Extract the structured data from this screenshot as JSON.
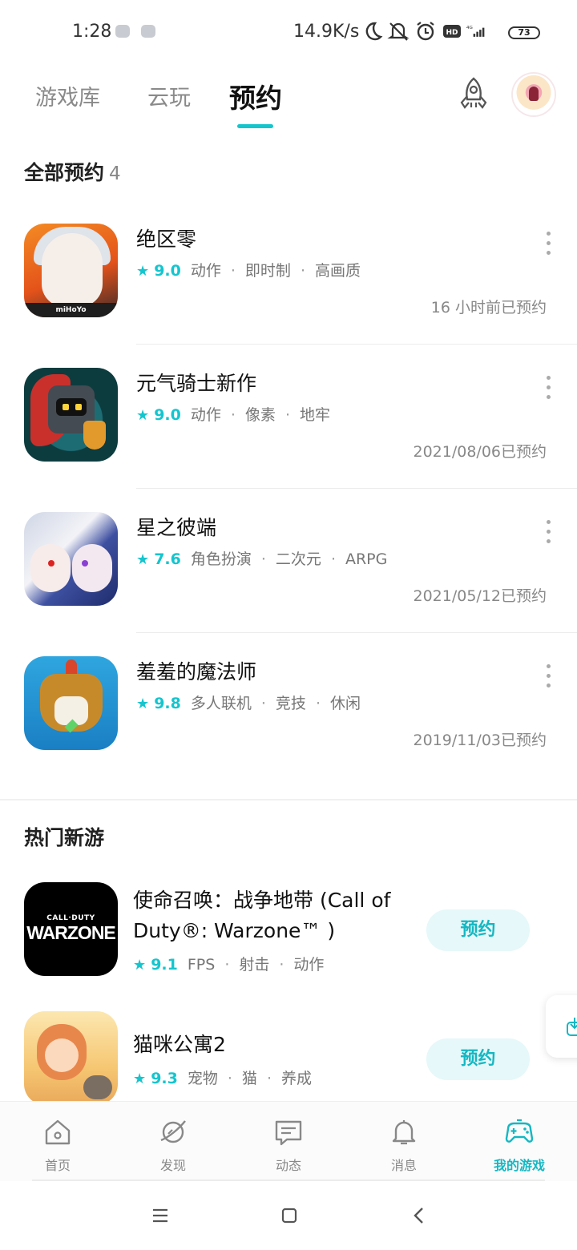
{
  "status_bar": {
    "time": "1:28",
    "net_speed": "14.9K/s",
    "network": "4G",
    "battery": "73",
    "icons": [
      "moon-icon",
      "mute-icon",
      "alarm-icon",
      "hd-icon",
      "signal-icon",
      "battery-icon"
    ]
  },
  "top_tabs": {
    "library": "游戏库",
    "cloud": "云玩",
    "reserve": "预约",
    "active": "预约"
  },
  "reserve_section": {
    "title": "全部预约",
    "count": "4",
    "items": [
      {
        "name": "绝区零",
        "score": "9.0",
        "tags": [
          "动作",
          "即时制",
          "高画质"
        ],
        "reserved_at": "16 小时前已预约",
        "icon_text": "miHoYo"
      },
      {
        "name": "元气骑士新作",
        "score": "9.0",
        "tags": [
          "动作",
          "像素",
          "地牢"
        ],
        "reserved_at": "2021/08/06已预约"
      },
      {
        "name": "星之彼端",
        "score": "7.6",
        "tags": [
          "角色扮演",
          "二次元",
          "ARPG"
        ],
        "reserved_at": "2021/05/12已预约"
      },
      {
        "name": "羞羞的魔法师",
        "score": "9.8",
        "tags": [
          "多人联机",
          "竞技",
          "休闲"
        ],
        "reserved_at": "2019/11/03已预约"
      }
    ]
  },
  "hot_section": {
    "title": "热门新游",
    "items": [
      {
        "name": "使命召唤：战争地带 (Call of Duty®: Warzone™ )",
        "score": "9.1",
        "tags": [
          "FPS",
          "射击",
          "动作"
        ],
        "button": "预约",
        "icon_small": "CALL·DUTY",
        "icon_big": "WARZONE"
      },
      {
        "name": "猫咪公寓2",
        "score": "9.3",
        "tags": [
          "宠物",
          "猫",
          "养成"
        ],
        "button": "预约"
      }
    ]
  },
  "bottom_nav": {
    "items": [
      {
        "label": "首页",
        "icon": "home-icon"
      },
      {
        "label": "发现",
        "icon": "planet-icon"
      },
      {
        "label": "动态",
        "icon": "feed-icon"
      },
      {
        "label": "消息",
        "icon": "bell-icon"
      },
      {
        "label": "我的游戏",
        "icon": "gamepad-icon"
      }
    ],
    "active": "我的游戏"
  },
  "colors": {
    "accent": "#15c5ce",
    "accent_text": "#15b7c2",
    "button_bg": "#e6f8f9"
  }
}
